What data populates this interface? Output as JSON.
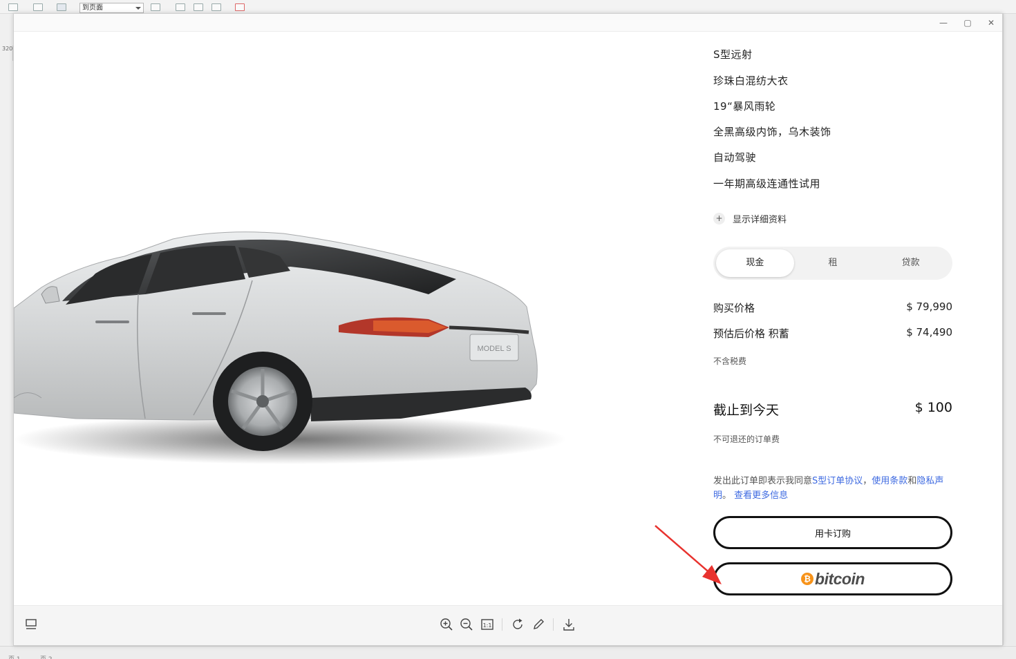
{
  "background_app": {
    "toolbar_select_value": "到页面",
    "ruler_value": "320",
    "page_tabs": [
      "页 1",
      "页 2"
    ]
  },
  "window_controls": {
    "minimize": "—",
    "maximize": "▢",
    "close": "✕"
  },
  "car": {
    "plate_text": "MODEL S",
    "paint_color": "#d8dadb"
  },
  "specs": [
    "S型远射",
    "珍珠白混纺大衣",
    "19“暴风雨轮",
    "全黑高级内饰，乌木装饰",
    "自动驾驶",
    "一年期高级连通性试用"
  ],
  "details_link": {
    "icon": "+",
    "label": "显示详细资料"
  },
  "payment_tabs": {
    "options": [
      "现金",
      "租",
      "贷款"
    ],
    "selected": "现金"
  },
  "pricing": {
    "purchase_label": "购买价格",
    "purchase_value": "$ 79,990",
    "after_savings_label": "预估后价格 积蓄",
    "after_savings_value": "$ 74,490",
    "tax_note": "不含税费",
    "due_today_label": "截止到今天",
    "due_today_value": "$ 100",
    "fee_note": "不可退还的订单费"
  },
  "legal": {
    "prefix": "发出此订单即表示我同意",
    "link_order": "S型订单协议",
    "sep1": "，",
    "link_terms": "使用条款",
    "and": "和",
    "link_privacy": "隐私声明",
    "sep2": "。 ",
    "link_more": "查看更多信息"
  },
  "buttons": {
    "card_label": "用卡订购",
    "bitcoin_symbol": "₿",
    "bitcoin_label": "bitcoin"
  },
  "colors": {
    "accent_link": "#3e6ae1",
    "bitcoin_orange": "#f7931a",
    "annotation_arrow": "#e8322e"
  },
  "bottom_toolbar": {
    "icons": [
      "thumbnail-icon",
      "zoom-in-icon",
      "zoom-out-icon",
      "actual-size-icon",
      "rotate-icon",
      "edit-icon",
      "download-icon"
    ],
    "actual_size_label": "1:1"
  }
}
